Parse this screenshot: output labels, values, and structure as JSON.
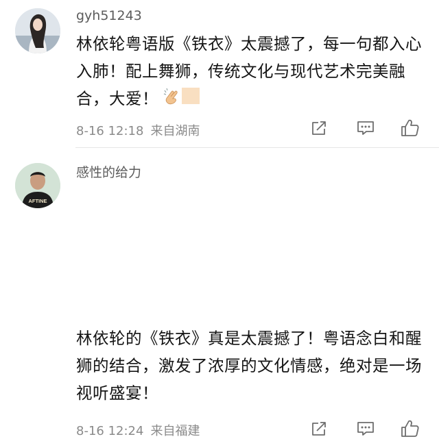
{
  "comments": [
    {
      "username": "gyh51243",
      "text": "林依轮粤语版《铁衣》太震撼了，每一句都入心入肺！配上舞狮，传统文化与现代艺术完美融合，大爱！",
      "emoji": "clapping-hands",
      "time": "8-16 12:18",
      "location": "来自湖南",
      "icons": {
        "share": "share-icon",
        "comment": "comment-icon",
        "like": "thumbs-up-icon"
      }
    },
    {
      "username": "感性的给力",
      "text": "林依轮的《铁衣》真是太震撼了！粤语念白和醒狮的结合，激发了浓厚的文化情感，绝对是一场视听盛宴！",
      "time": "8-16 12:24",
      "location": "来自福建",
      "avatar_shirt_text": "AFTINE",
      "icons": {
        "share": "share-icon",
        "comment": "comment-icon",
        "like": "thumbs-up-icon"
      }
    }
  ]
}
